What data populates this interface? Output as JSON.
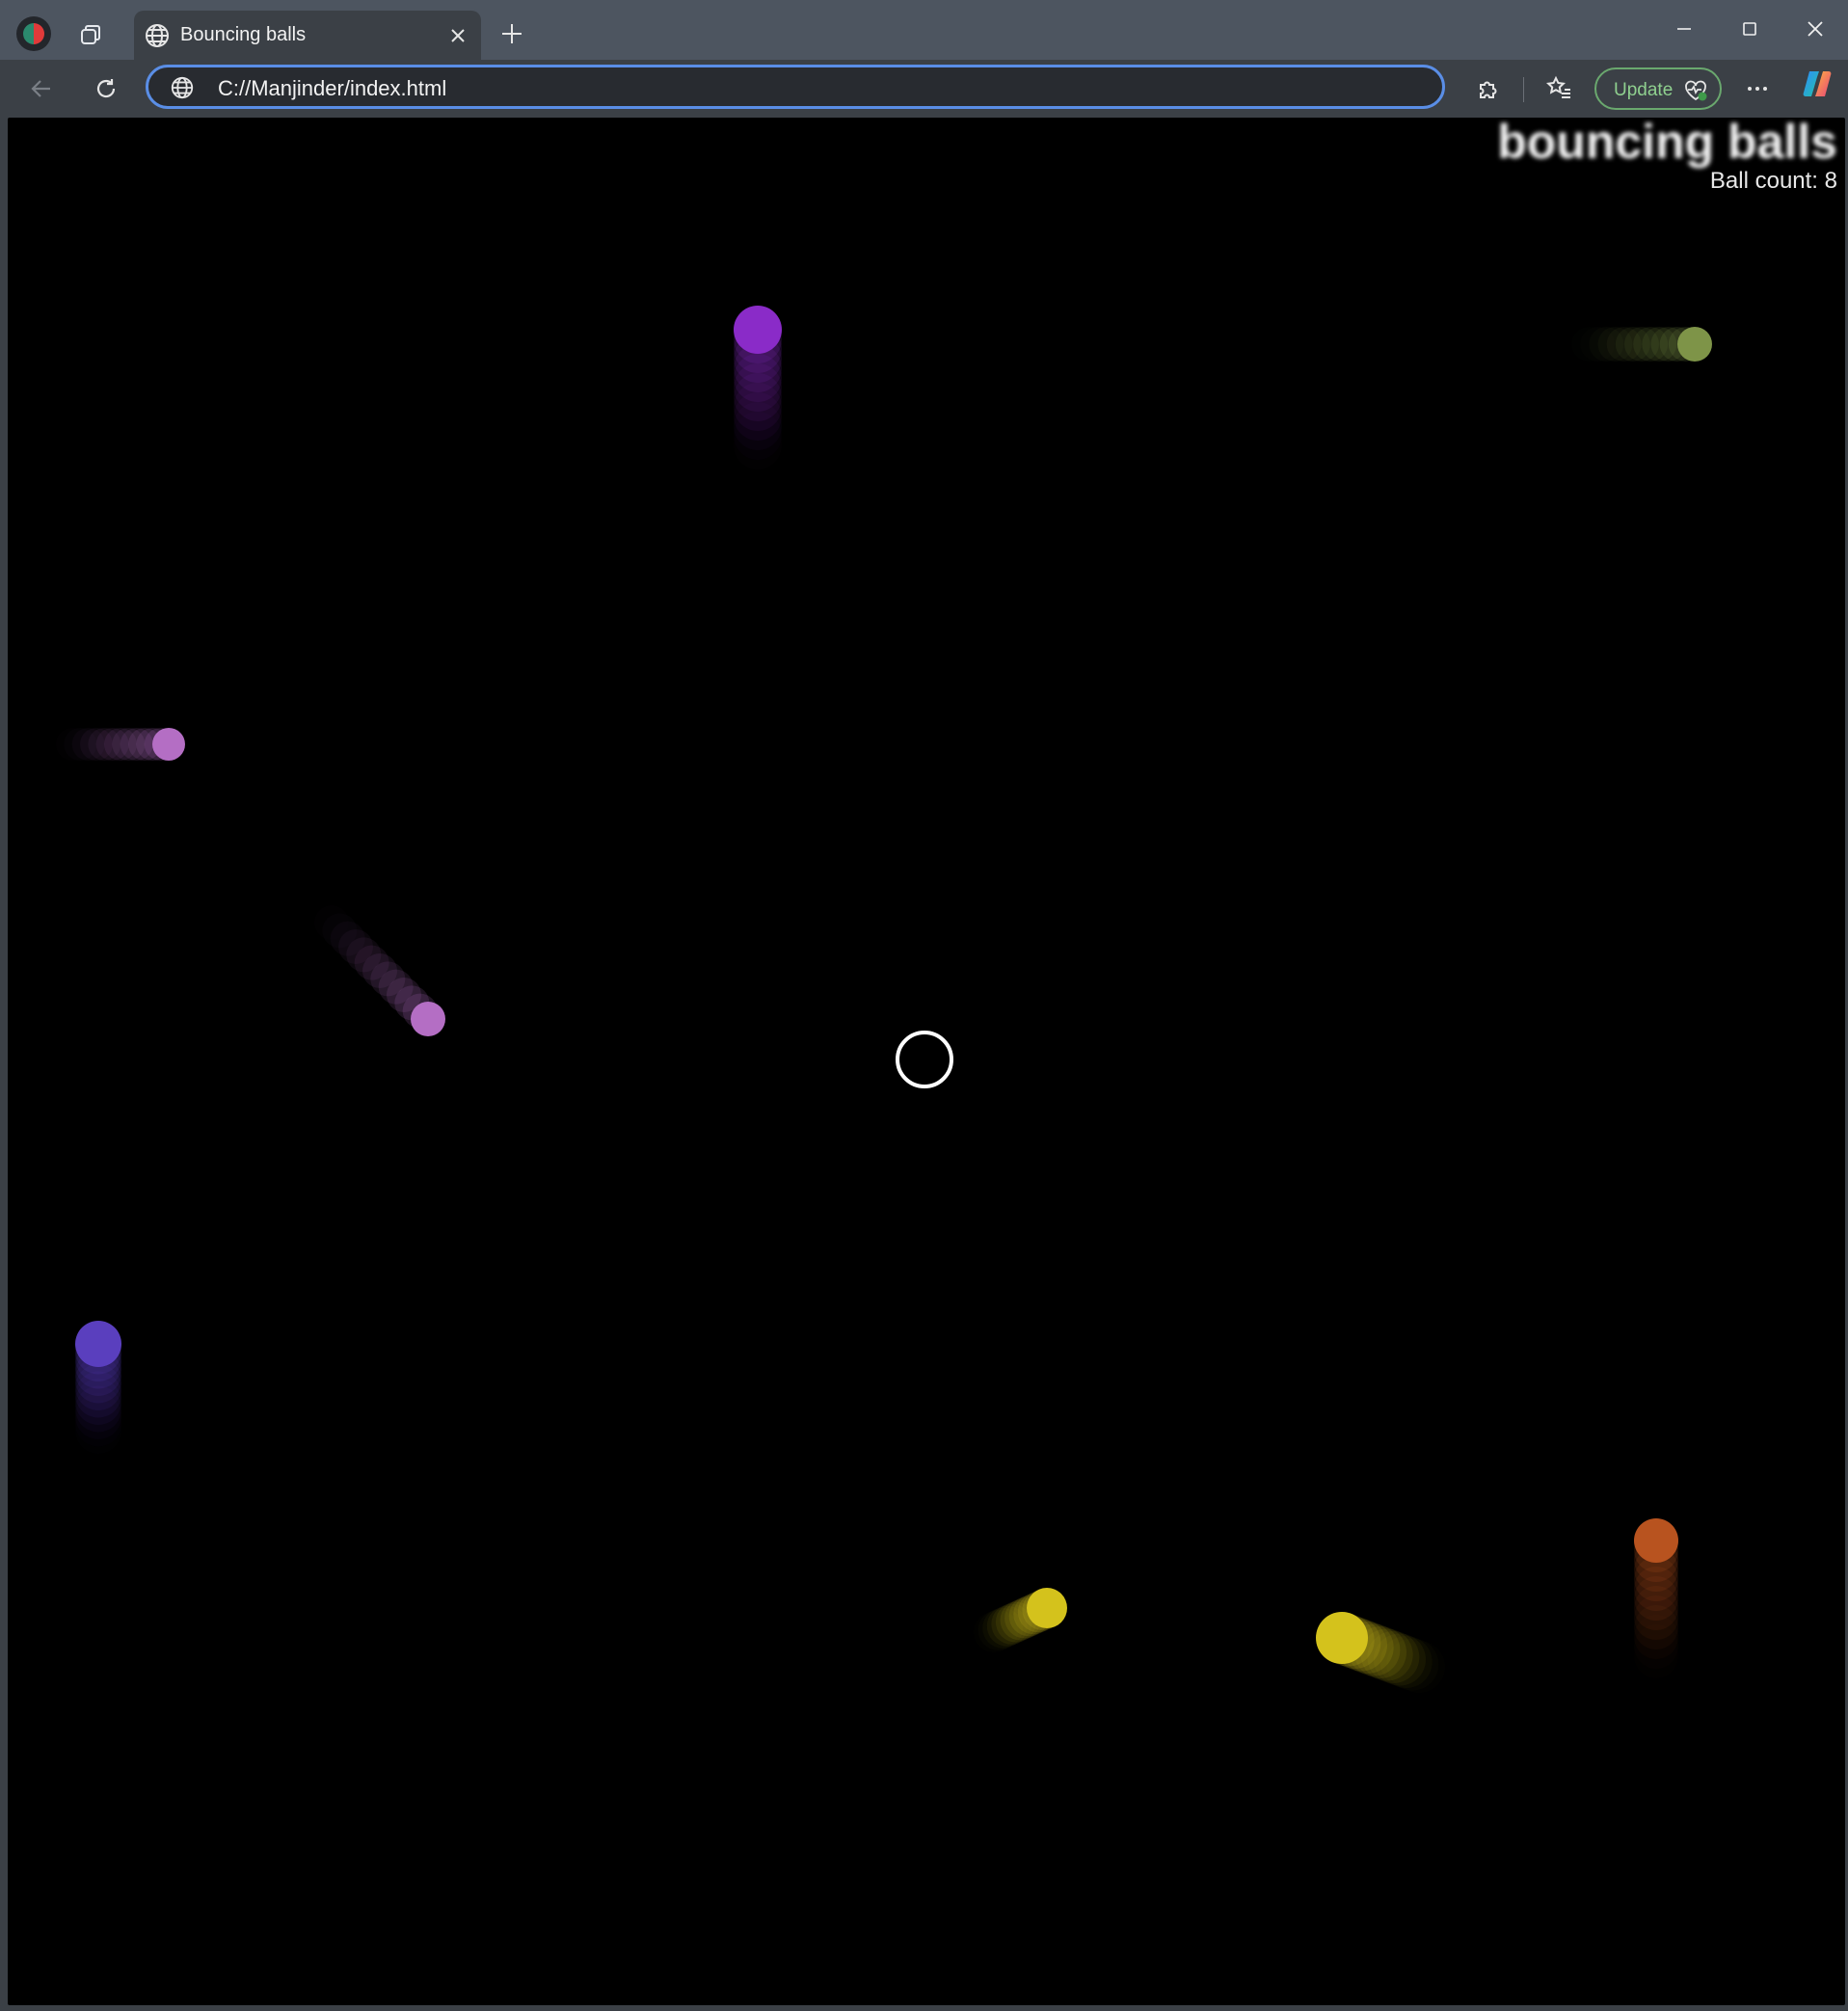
{
  "browser": {
    "tab": {
      "title": "Bouncing balls"
    },
    "address_bar": {
      "url": "C://Manjinder/index.html"
    },
    "update_button": {
      "label": "Update"
    },
    "icons": {
      "profile": "profile-avatar-icon",
      "workspaces": "workspaces-icon",
      "tab_site": "globe-icon",
      "tab_close": "close-icon",
      "new_tab": "plus-icon",
      "minimize": "minimize-icon",
      "maximize": "maximize-icon",
      "close_window": "close-icon",
      "back": "back-arrow-icon",
      "refresh": "refresh-icon",
      "site_info": "globe-icon",
      "extensions": "puzzle-icon",
      "favorites": "star-list-icon",
      "update_health": "heart-pulse-icon",
      "more": "more-icon",
      "copilot": "copilot-icon"
    }
  },
  "page": {
    "heading": "bouncing balls",
    "ball_count_text": "Ball count: 8",
    "background_color": "#000000",
    "balls": [
      {
        "color": "#8a2bc8",
        "motion": "up"
      },
      {
        "color": "#7e9448",
        "motion": "right"
      },
      {
        "color": "#b46ec4",
        "motion": "right"
      },
      {
        "color": "#b46ec4",
        "motion": "down-right"
      },
      {
        "color": "#5a3fbe",
        "motion": "down"
      },
      {
        "color": "#b8531f",
        "motion": "down"
      },
      {
        "color": "#d4c21c",
        "motion": "up-right"
      },
      {
        "color": "#d4c21c",
        "motion": "left"
      }
    ]
  }
}
